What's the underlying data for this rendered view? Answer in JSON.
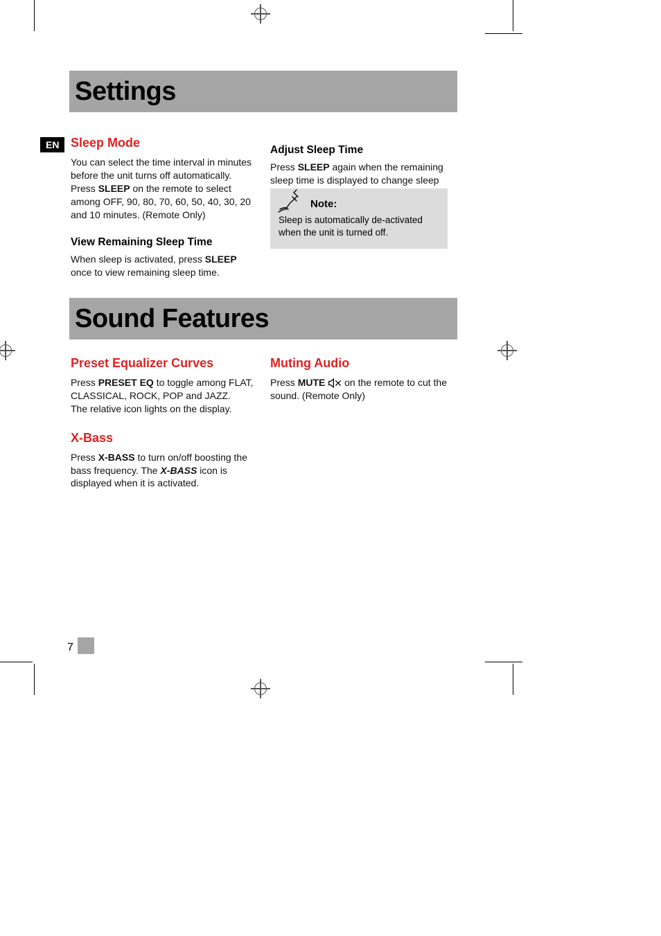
{
  "crop": {
    "lang_badge": "EN",
    "page_number": "7"
  },
  "banners": {
    "settings": "Settings",
    "sound_features": "Sound Features"
  },
  "left_col": {
    "sleep_mode": {
      "title": "Sleep Mode",
      "p1_a": "You can select the time interval in minutes before the unit turns off automatically.",
      "p2_a": "Press ",
      "p2_b": "SLEEP",
      "p2_c": " on the remote to select among OFF, 90, 80, 70, 60, 50, 40, 30, 20 and 10 minutes. (Remote Only)"
    },
    "view_remaining": {
      "title": "View Remaining Sleep Time",
      "p_a": "When sleep is activated, press ",
      "p_b": "SLEEP",
      "p_c": " once to view remaining sleep time."
    },
    "preset_eq": {
      "title": "Preset Equalizer Curves",
      "p_a": "Press ",
      "p_b": "PRESET EQ",
      "p_c": " to toggle among FLAT, CLASSICAL, ROCK, POP and JAZZ.",
      "p2": "The relative icon lights on the display."
    },
    "xbass": {
      "title": "X-Bass",
      "p_a": "Press ",
      "p_b": "X-BASS",
      "p_c": " to turn on/off boosting the bass frequency. The ",
      "p_d": "X-BASS",
      "p_e": " icon is displayed when it is activated."
    }
  },
  "right_col": {
    "adjust_sleep": {
      "title": "Adjust Sleep Time",
      "p_a": "Press ",
      "p_b": "SLEEP",
      "p_c": " again when the remaining sleep time is displayed to change sleep time."
    },
    "note": {
      "label": "Note:",
      "body": "Sleep is automatically de-activated when the unit is turned off."
    },
    "muting": {
      "title": "Muting Audio",
      "p_a": "Press ",
      "p_b": "MUTE",
      "p_c": " on the remote to cut the sound. (Remote Only)"
    }
  }
}
